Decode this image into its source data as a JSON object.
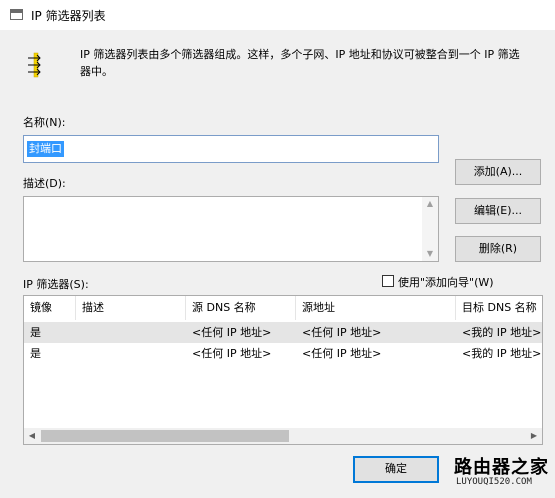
{
  "window": {
    "title": "IP 筛选器列表"
  },
  "intro": {
    "text": "IP 筛选器列表由多个筛选器组成。这样，多个子网、IP 地址和协议可被整合到一个 IP 筛选器中。"
  },
  "name": {
    "label": "名称(N):",
    "value": "封端口"
  },
  "description": {
    "label": "描述(D):",
    "value": ""
  },
  "buttons": {
    "add": "添加(A)...",
    "edit": "编辑(E)...",
    "delete": "删除(R)",
    "ok": "确定"
  },
  "filters": {
    "label": "IP 筛选器(S):",
    "wizard_label": "使用\"添加向导\"(W)",
    "wizard_checked": false,
    "columns": [
      "镜像",
      "描述",
      "源 DNS 名称",
      "源地址",
      "目标 DNS 名称"
    ],
    "rows": [
      [
        "是",
        "",
        "<任何 IP 地址>",
        "<任何 IP 地址>",
        "<我的 IP 地址>"
      ],
      [
        "是",
        "",
        "<任何 IP 地址>",
        "<任何 IP 地址>",
        "<我的 IP 地址>"
      ]
    ]
  },
  "watermark": {
    "main": "路由器之家",
    "sub": "LUYOUQI520.COM"
  },
  "colors": {
    "selection": "#3399ff",
    "focus_border": "#0078d7"
  }
}
